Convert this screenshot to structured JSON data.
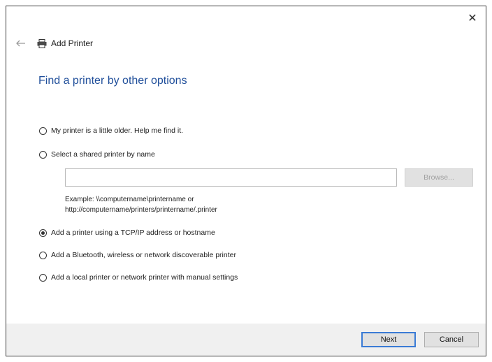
{
  "window": {
    "title": "Add Printer",
    "close_glyph": "✕",
    "back_glyph": "←"
  },
  "heading": "Find a printer by other options",
  "options": [
    {
      "label": "My printer is a little older. Help me find it.",
      "checked": false
    },
    {
      "label": "Select a shared printer by name",
      "checked": false
    },
    {
      "label": "Add a printer using a TCP/IP address or hostname",
      "checked": true
    },
    {
      "label": "Add a Bluetooth, wireless or network discoverable printer",
      "checked": false
    },
    {
      "label": "Add a local printer or network printer with manual settings",
      "checked": false
    }
  ],
  "shared_name": {
    "value": "",
    "browse_label": "Browse...",
    "example_line1": "Example: \\\\computername\\printername or",
    "example_line2": "http://computername/printers/printername/.printer"
  },
  "footer": {
    "next_label": "Next",
    "cancel_label": "Cancel"
  },
  "icons": {
    "printer": "printer-icon",
    "back": "back-arrow-icon",
    "close": "close-icon"
  },
  "colors": {
    "heading": "#1f4e9a",
    "primary_button_border": "#3a7bd5",
    "footer_bg": "#f0f0f0"
  }
}
